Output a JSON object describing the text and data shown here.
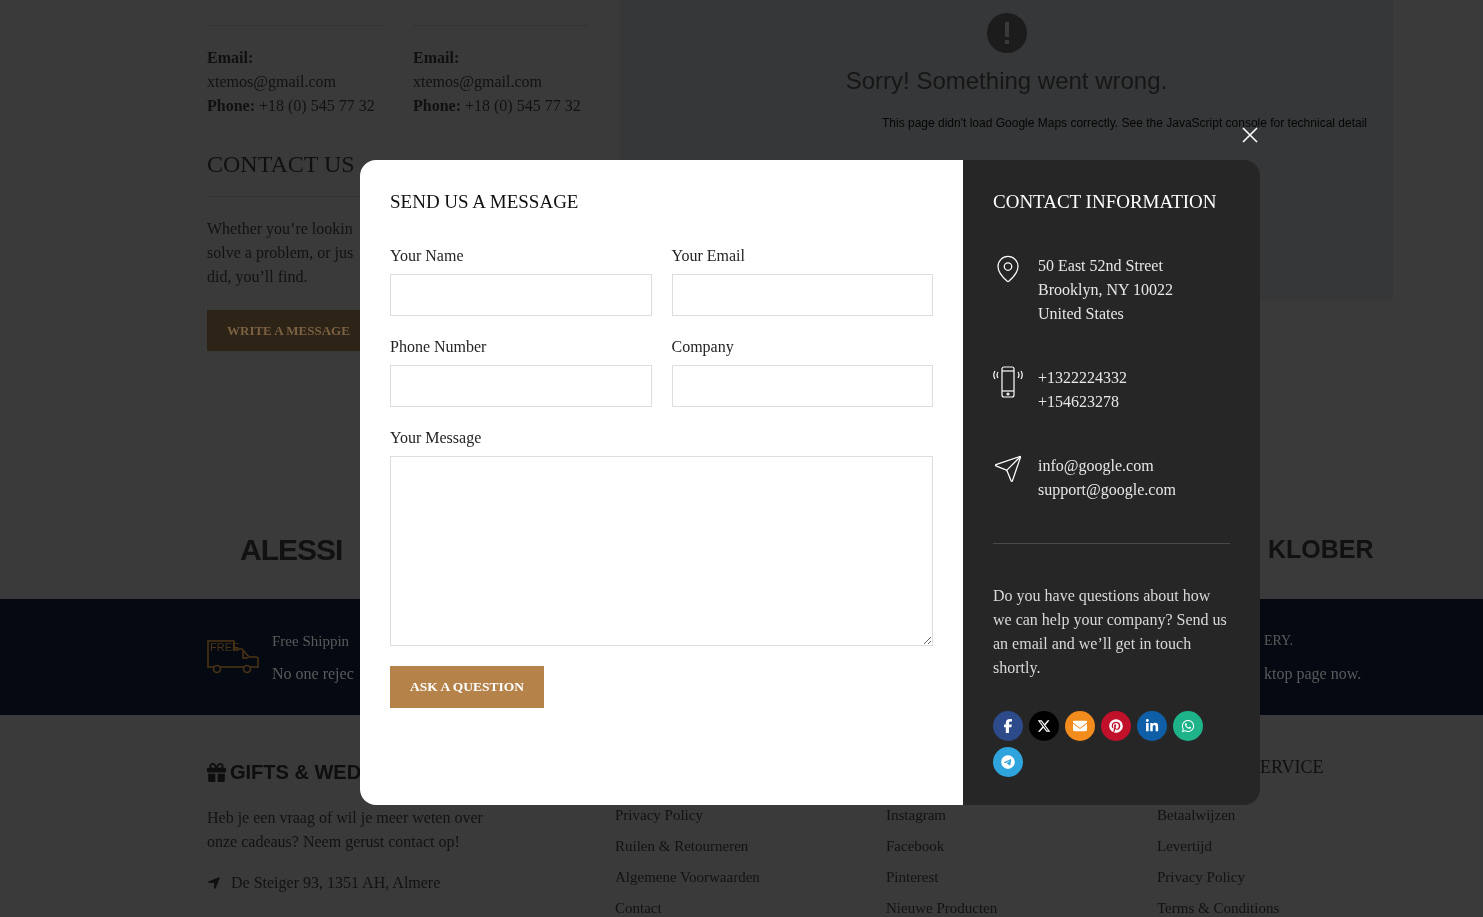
{
  "background_page": {
    "contact_cards": [
      {
        "email_label": "Email:",
        "email": "xtemos@gmail.com",
        "phone_label": "Phone:",
        "phone": "+18 (0) 545 77 32"
      },
      {
        "email_label": "Email:",
        "email": "xtemos@gmail.com",
        "phone_label": "Phone:",
        "phone": "+18 (0) 545 77 32"
      }
    ],
    "contact_us": {
      "title": "CONTACT US",
      "text_lines": [
        "Whether you’re lookin",
        "solve a problem, or jus",
        "did, you’ll find."
      ],
      "button": "WRITE A MESSAGE"
    },
    "map_error": {
      "title": "Sorry! Something went wrong.",
      "message": "This page didn't load Google Maps correctly. See the JavaScript console for technical detail"
    },
    "brands": [
      "ALESSI",
      "KLOBER"
    ],
    "features": {
      "left": {
        "badge": "FREE",
        "title": "Free Shippin",
        "text": "No one rejec"
      },
      "right": {
        "title": "ERY.",
        "text": "ktop page now."
      }
    },
    "footer": {
      "brand": "GIFTS & WED",
      "about": "Heb je een vraag of wil je meer weten over onze cadeaus? Neem gerust contact op!",
      "address": "De Steiger 93, 1351 AH, Almere",
      "columns": [
        {
          "links": [
            "Privacy Policy",
            "Ruilen & Retourneren",
            "Algemene Voorwaarden",
            "Contact"
          ]
        },
        {
          "links": [
            "Instagram",
            "Facebook",
            "Pinterest",
            "Nieuwe Producten"
          ]
        },
        {
          "heading": "ERVICE",
          "links": [
            "Betaalwijzen",
            "Levertijd",
            "Privacy Policy",
            "Terms & Conditions"
          ]
        }
      ]
    }
  },
  "modal": {
    "title": "SEND US A MESSAGE",
    "fields": [
      {
        "label": "Your Name",
        "kind": "input"
      },
      {
        "label": "Your Email",
        "kind": "input"
      },
      {
        "label": "Phone Number",
        "kind": "input"
      },
      {
        "label": "Company",
        "kind": "input"
      },
      {
        "label": "Your Message",
        "kind": "textarea"
      }
    ],
    "submit": "ASK A QUESTION",
    "info": {
      "title": "CONTACT INFORMATION",
      "items": [
        {
          "kind": "address",
          "lines": [
            "50 East 52nd Street",
            "Brooklyn, NY 10022",
            "United States"
          ]
        },
        {
          "kind": "phone",
          "lines": [
            "+1322224332",
            "+154623278"
          ]
        },
        {
          "kind": "email",
          "lines": [
            "info@google.com",
            "support@google.com"
          ]
        }
      ],
      "text": "Do you have questions about how we can help your company? Send us an email and we’ll get in touch shortly.",
      "socials": [
        {
          "kind": "facebook",
          "color": "#2d4a8a"
        },
        {
          "kind": "x",
          "color": "#000000"
        },
        {
          "kind": "email",
          "color": "#f28c1c"
        },
        {
          "kind": "pinterest",
          "color": "#c0102a"
        },
        {
          "kind": "linkedin",
          "color": "#0e5fa8"
        },
        {
          "kind": "whatsapp",
          "color": "#1fb38a"
        },
        {
          "kind": "telegram",
          "color": "#2ea3dc"
        }
      ]
    }
  }
}
